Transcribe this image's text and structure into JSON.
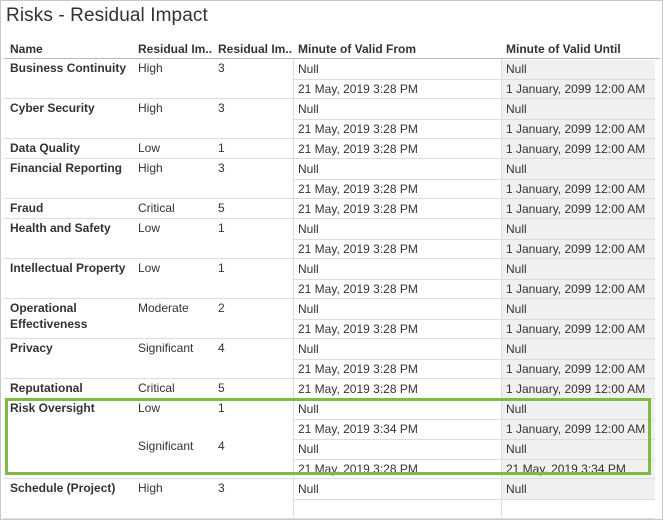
{
  "title": "Risks - Residual Impact",
  "headers": {
    "name": "Name",
    "residual_impact_label": "Residual Im..",
    "residual_impact_value": "Residual Im..",
    "valid_from": "Minute of Valid From",
    "valid_until": "Minute of Valid Until"
  },
  "rows": [
    {
      "name": "Business Continuity",
      "impact": "High",
      "score": "3",
      "lines": [
        {
          "from": "Null",
          "until": "Null"
        },
        {
          "from": "21 May, 2019 3:28 PM",
          "until": "1 January, 2099 12:00 AM"
        }
      ]
    },
    {
      "name": "Cyber Security",
      "impact": "High",
      "score": "3",
      "lines": [
        {
          "from": "Null",
          "until": "Null"
        },
        {
          "from": "21 May, 2019 3:28 PM",
          "until": "1 January, 2099 12:00 AM"
        }
      ]
    },
    {
      "name": "Data Quality",
      "impact": "Low",
      "score": "1",
      "lines": [
        {
          "from": "21 May, 2019 3:28 PM",
          "until": "1 January, 2099 12:00 AM"
        }
      ]
    },
    {
      "name": "Financial Reporting",
      "impact": "High",
      "score": "3",
      "lines": [
        {
          "from": "Null",
          "until": "Null"
        },
        {
          "from": "21 May, 2019 3:28 PM",
          "until": "1 January, 2099 12:00 AM"
        }
      ]
    },
    {
      "name": "Fraud",
      "impact": "Critical",
      "score": "5",
      "lines": [
        {
          "from": "21 May, 2019 3:28 PM",
          "until": "1 January, 2099 12:00 AM"
        }
      ]
    },
    {
      "name": "Health and Safety",
      "impact": "Low",
      "score": "1",
      "lines": [
        {
          "from": "Null",
          "until": "Null"
        },
        {
          "from": "21 May, 2019 3:28 PM",
          "until": "1 January, 2099 12:00 AM"
        }
      ]
    },
    {
      "name": "Intellectual Property",
      "impact": "Low",
      "score": "1",
      "lines": [
        {
          "from": "Null",
          "until": "Null"
        },
        {
          "from": "21 May, 2019 3:28 PM",
          "until": "1 January, 2099 12:00 AM"
        }
      ]
    },
    {
      "name": "Operational",
      "name2": "Effectiveness",
      "impact": "Moderate",
      "score": "2",
      "lines": [
        {
          "from": "Null",
          "until": "Null"
        },
        {
          "from": "21 May, 2019 3:28 PM",
          "until": "1 January, 2099 12:00 AM"
        }
      ]
    },
    {
      "name": "Privacy",
      "impact": "Significant",
      "score": "4",
      "lines": [
        {
          "from": "Null",
          "until": "Null"
        },
        {
          "from": "21 May, 2019 3:28 PM",
          "until": "1 January, 2099 12:00 AM"
        }
      ]
    },
    {
      "name": "Reputational",
      "impact": "Critical",
      "score": "5",
      "lines": [
        {
          "from": "21 May, 2019 3:28 PM",
          "until": "1 January, 2099 12:00 AM"
        }
      ]
    },
    {
      "name": "Risk Oversight",
      "impact": "Low",
      "score": "1",
      "highlighted": true,
      "lines": [
        {
          "from": "Null",
          "until": "Null"
        },
        {
          "from": "21 May, 2019 3:34 PM",
          "until": "1 January, 2099 12:00 AM"
        }
      ],
      "sub": {
        "impact": "Significant",
        "score": "4",
        "lines": [
          {
            "from": "Null",
            "until": "Null"
          },
          {
            "from": "21 May, 2019 3:28 PM",
            "until": "21 May, 2019 3:34 PM"
          }
        ]
      }
    },
    {
      "name": "Schedule (Project)",
      "impact": "High",
      "score": "3",
      "lines": [
        {
          "from": "Null",
          "until": "Null"
        },
        {
          "from": "",
          "until": ""
        }
      ]
    }
  ],
  "colors": {
    "highlight_border": "#7dbb42",
    "shaded_cell": "#f0f0f0",
    "grid_line": "#dcdcdc"
  }
}
